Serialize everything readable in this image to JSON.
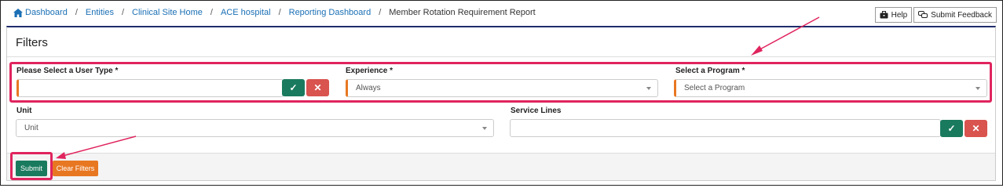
{
  "breadcrumb": {
    "items": [
      "Dashboard",
      "Entities",
      "Clinical Site Home",
      "ACE hospital",
      "Reporting Dashboard"
    ],
    "current": "Member Rotation Requirement Report",
    "separator": "/"
  },
  "header_buttons": {
    "help": "Help",
    "feedback": "Submit Feedback"
  },
  "filters": {
    "title": "Filters",
    "user_type": {
      "label": "Please Select a User Type *",
      "value": ""
    },
    "experience": {
      "label": "Experience *",
      "value": "Always"
    },
    "program": {
      "label": "Select a Program *",
      "value": "Select a Program"
    },
    "unit": {
      "label": "Unit",
      "value": "Unit"
    },
    "service_lines": {
      "label": "Service Lines",
      "value": ""
    },
    "confirm_symbol": "✓",
    "clear_symbol": "✕"
  },
  "actions": {
    "submit": "Submit",
    "clear": "Clear Filters"
  },
  "colors": {
    "link": "#1a6fb5",
    "accent_green": "#1a7a5e",
    "accent_red": "#d9534f",
    "accent_orange": "#e87722",
    "annotation_pink": "#e0245e",
    "card_top_border": "#1f2c6b"
  },
  "icons": [
    "home-icon",
    "briefcase-icon",
    "feedback-icon",
    "check-icon",
    "close-icon",
    "chevron-down-icon"
  ]
}
